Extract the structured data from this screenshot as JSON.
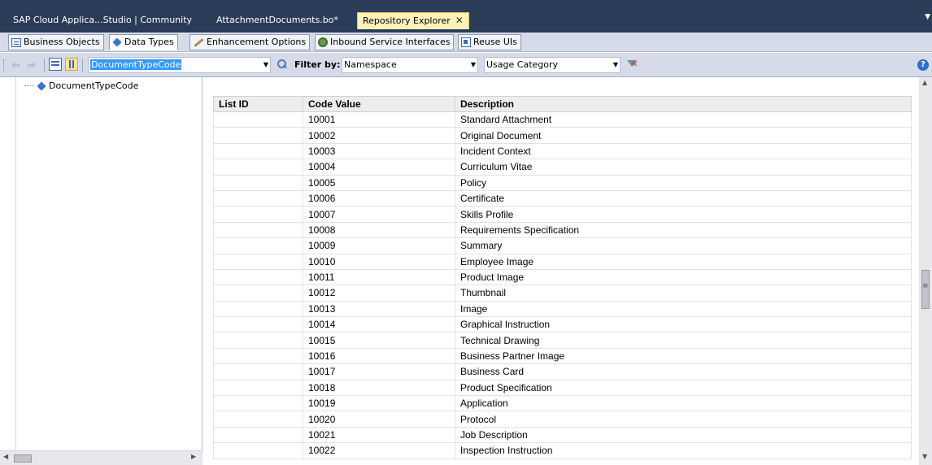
{
  "document_tabs": [
    {
      "label": "SAP Cloud Applica...Studio | Community",
      "active": false
    },
    {
      "label": "AttachmentDocuments.bo*",
      "active": false
    },
    {
      "label": "Repository Explorer",
      "active": true
    }
  ],
  "type_tabs": [
    {
      "label": "Business Objects",
      "icon": "business-object-icon"
    },
    {
      "label": "Data Types",
      "icon": "data-type-icon",
      "active": true
    },
    {
      "label": "Enhancement Options",
      "icon": "wand-icon"
    },
    {
      "label": "Inbound Service Interfaces",
      "icon": "gear-icon"
    },
    {
      "label": "Reuse UIs",
      "icon": "reuse-ui-icon"
    }
  ],
  "toolbar": {
    "type_combo_value": "DocumentTypeCode",
    "filter_label": "Filter by:",
    "namespace_value": "Namespace",
    "usage_category_value": "Usage Category"
  },
  "tree": {
    "node_label": "DocumentTypeCode"
  },
  "table": {
    "headers": [
      "List ID",
      "Code Value",
      "Description"
    ],
    "rows": [
      [
        "",
        "10001",
        "Standard Attachment"
      ],
      [
        "",
        "10002",
        "Original Document"
      ],
      [
        "",
        "10003",
        "Incident Context"
      ],
      [
        "",
        "10004",
        "Curriculum Vitae"
      ],
      [
        "",
        "10005",
        "Policy"
      ],
      [
        "",
        "10006",
        "Certificate"
      ],
      [
        "",
        "10007",
        "Skills Profile"
      ],
      [
        "",
        "10008",
        "Requirements Specification"
      ],
      [
        "",
        "10009",
        "Summary"
      ],
      [
        "",
        "10010",
        "Employee Image"
      ],
      [
        "",
        "10011",
        "Product Image"
      ],
      [
        "",
        "10012",
        "Thumbnail"
      ],
      [
        "",
        "10013",
        "Image"
      ],
      [
        "",
        "10014",
        "Graphical Instruction"
      ],
      [
        "",
        "10015",
        "Technical Drawing"
      ],
      [
        "",
        "10016",
        "Business Partner Image"
      ],
      [
        "",
        "10017",
        "Business Card"
      ],
      [
        "",
        "10018",
        "Product Specification"
      ],
      [
        "",
        "10019",
        "Application"
      ],
      [
        "",
        "10020",
        "Protocol"
      ],
      [
        "",
        "10021",
        "Job Description"
      ],
      [
        "",
        "10022",
        "Inspection Instruction"
      ]
    ]
  },
  "colors": {
    "tab_strip": "#2b3c59",
    "active_doc_tab": "#fff1b8",
    "toolbar": "#d6dbe9",
    "selection": "#3399ff"
  }
}
